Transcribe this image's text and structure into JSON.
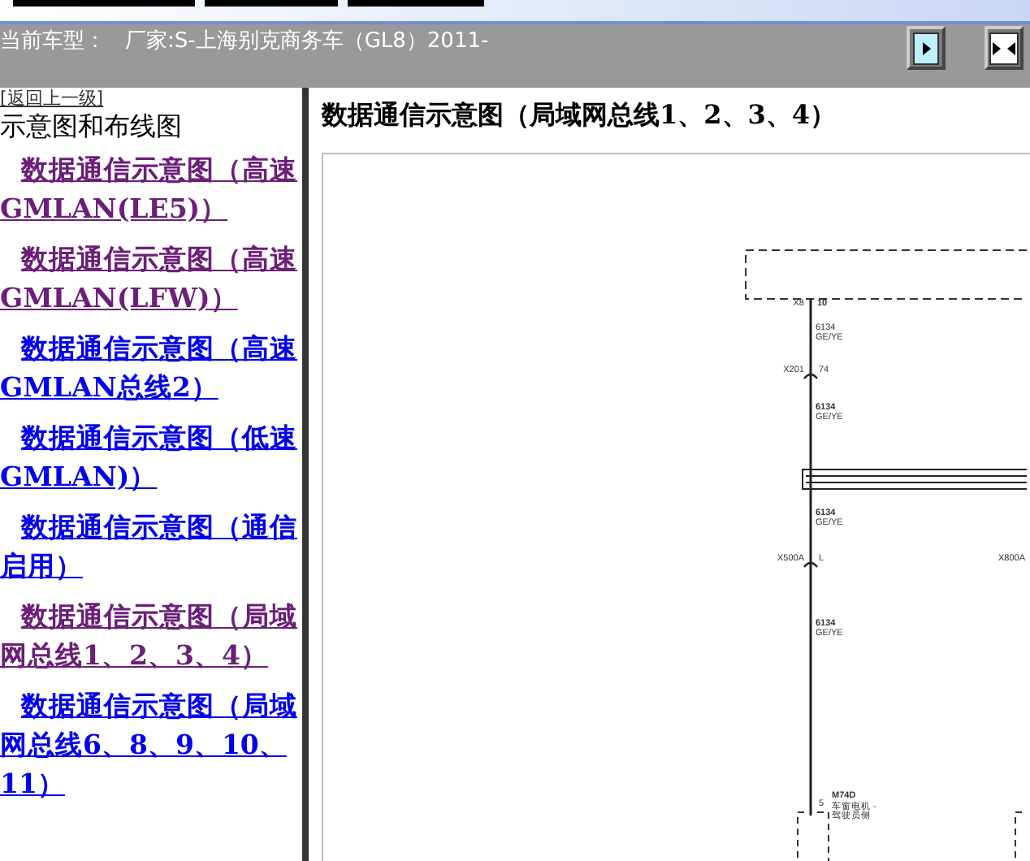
{
  "header": {
    "label": "当前车型：",
    "vehicle": "厂家:S-上海别克商务车（GL8）2011-"
  },
  "sidebar": {
    "back_link": "[返回上一级]",
    "section_title": "示意图和布线图",
    "links": [
      {
        "text": "数据通信示意图（高速GMLAN(LE5)）",
        "visited": true
      },
      {
        "text": "数据通信示意图（高速GMLAN(LFW)）",
        "visited": true
      },
      {
        "text": "数据通信示意图（高速GMLAN总线2）",
        "visited": false
      },
      {
        "text": "数据通信示意图（低速GMLAN)）",
        "visited": false
      },
      {
        "text": "数据通信示意图（通信启用）",
        "visited": false
      },
      {
        "text": "数据通信示意图（局域网总线1、2、3、4）",
        "visited": true
      },
      {
        "text": "数据通信示意图（局域网总线6、8、9、10、11）",
        "visited": false
      }
    ]
  },
  "content": {
    "title": "数据通信示意图（局域网总线1、2、3、4）",
    "diagram": {
      "top_connector": "X8",
      "top_pin": "10",
      "wire_labels": [
        {
          "circuit": "6134",
          "wire_color": "GE/YE"
        },
        {
          "circuit": "6134",
          "wire_color": "GE/YE"
        },
        {
          "circuit": "6134",
          "wire_color": "GE/YE"
        },
        {
          "circuit": "6134",
          "wire_color": "GE/YE"
        }
      ],
      "inline_connectors": [
        {
          "name": "X201",
          "pin": "74"
        },
        {
          "name": "X500A",
          "pin": "L"
        }
      ],
      "side_connector": "X800A",
      "component": {
        "pin": "5",
        "name": "M74D",
        "description": [
          "车窗电机 -",
          "驾驶员侧"
        ]
      }
    }
  }
}
